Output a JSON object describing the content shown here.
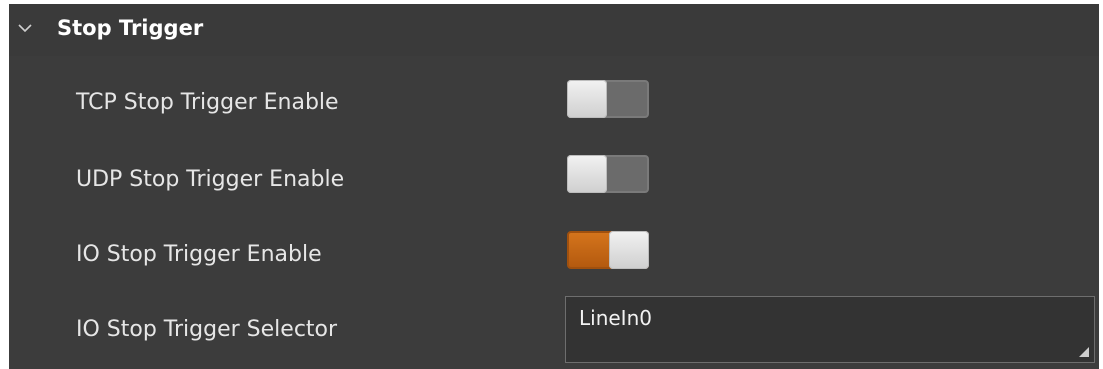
{
  "section": {
    "title": "Stop Trigger",
    "expanded": true,
    "chevron_icon": "chevron-down-icon"
  },
  "rows": [
    {
      "label": "TCP Stop Trigger Enable",
      "type": "toggle",
      "value": false
    },
    {
      "label": "UDP Stop Trigger Enable",
      "type": "toggle",
      "value": false
    },
    {
      "label": "IO Stop Trigger Enable",
      "type": "toggle",
      "value": true
    },
    {
      "label": "IO Stop Trigger Selector",
      "type": "select",
      "value": "LineIn0"
    }
  ],
  "colors": {
    "panel_background": "#3c3c3c",
    "text": "#e6e6e6",
    "toggle_on": "#c8661a",
    "toggle_off": "#6b6b6b"
  }
}
